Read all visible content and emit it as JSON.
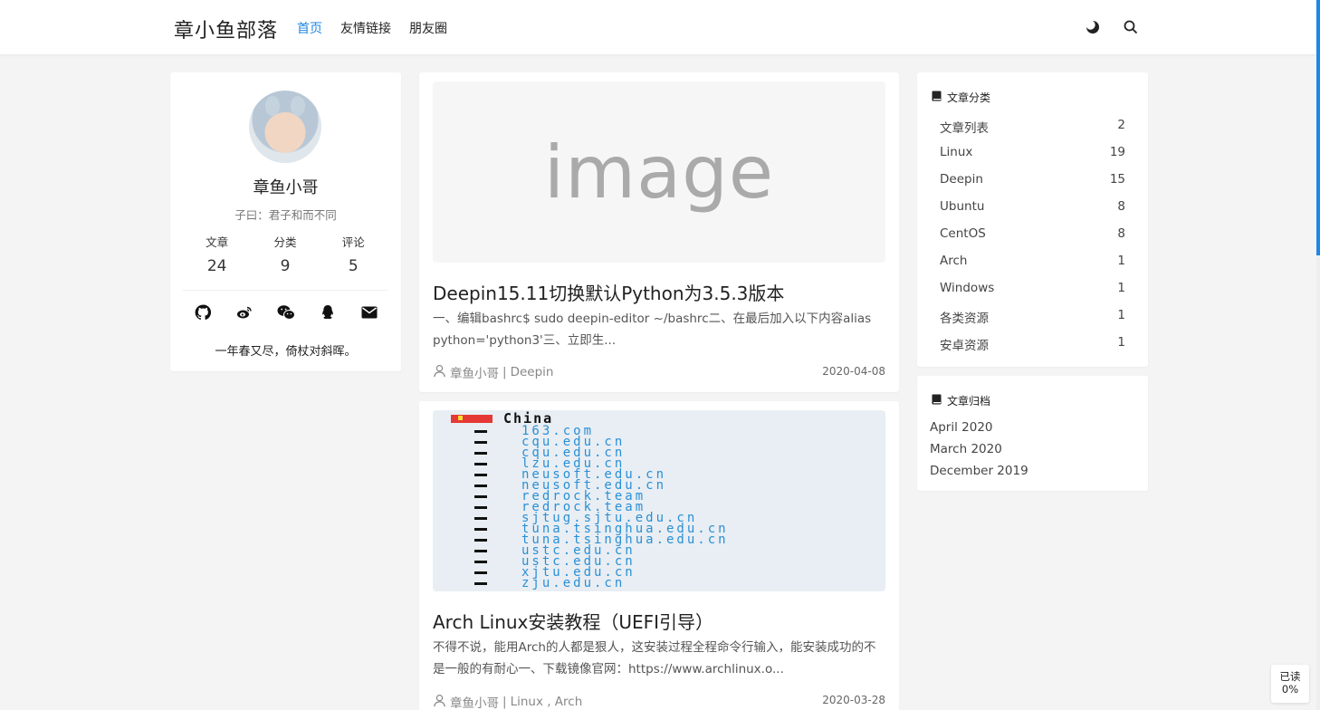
{
  "header": {
    "brand": "章小鱼部落",
    "nav": [
      {
        "label": "首页",
        "active": true
      },
      {
        "label": "友情链接",
        "active": false
      },
      {
        "label": "朋友圈",
        "active": false
      }
    ],
    "icons": [
      "dark-mode-icon",
      "search-icon"
    ]
  },
  "profile": {
    "name": "章鱼小哥",
    "motto": "子曰：君子和而不同",
    "stats": [
      {
        "label": "文章",
        "value": "24"
      },
      {
        "label": "分类",
        "value": "9"
      },
      {
        "label": "评论",
        "value": "5"
      }
    ],
    "social_icons": [
      "github-icon",
      "weibo-icon",
      "wechat-icon",
      "qq-icon",
      "mail-icon"
    ],
    "quote": "一年春又尽，倚杖对斜晖。"
  },
  "posts": [
    {
      "thumb_text": "image",
      "title": "Deepin15.11切换默认Python为3.5.3版本",
      "excerpt": "一、编辑bashrc$ sudo deepin-editor ~/bashrc二、在最后加入以下内容alias python='python3'三、立即生...",
      "author": "章鱼小哥",
      "categories": "Deepin",
      "date": "2020-04-08"
    },
    {
      "thumb_country": "China",
      "thumb_mirrors": [
        "163.com",
        "cqu.edu.cn",
        "cqu.edu.cn",
        "lzu.edu.cn",
        "neusoft.edu.cn",
        "neusoft.edu.cn",
        "redrock.team",
        "redrock.team",
        "sjtug.sjtu.edu.cn",
        "tuna.tsinghua.edu.cn",
        "tuna.tsinghua.edu.cn",
        "ustc.edu.cn",
        "ustc.edu.cn",
        "xjtu.edu.cn",
        "zju.edu.cn"
      ],
      "title": "Arch Linux安装教程（UEFI引导）",
      "excerpt": "不得不说，能用Arch的人都是狠人，这安装过程全程命令行输入，能安装成功的不是一般的有耐心一、下载镜像官网：https://www.archlinux.o...",
      "author": "章鱼小哥",
      "categories": "Linux , Arch",
      "date": "2020-03-28"
    }
  ],
  "sidebar": {
    "categories_title": "文章分类",
    "categories": [
      {
        "name": "文章列表",
        "count": "2"
      },
      {
        "name": "Linux",
        "count": "19"
      },
      {
        "name": "Deepin",
        "count": "15"
      },
      {
        "name": "Ubuntu",
        "count": "8"
      },
      {
        "name": "CentOS",
        "count": "8"
      },
      {
        "name": "Arch",
        "count": "1"
      },
      {
        "name": "Windows",
        "count": "1"
      },
      {
        "name": "各类资源",
        "count": "1"
      },
      {
        "name": "安卓资源",
        "count": "1"
      }
    ],
    "archive_title": "文章归档",
    "archive": [
      "April 2020",
      "March 2020",
      "December 2019"
    ]
  },
  "read_progress": {
    "label": "已读",
    "percent": "0%"
  },
  "colors": {
    "accent": "#1e88e5",
    "background": "#f4f4f5"
  }
}
